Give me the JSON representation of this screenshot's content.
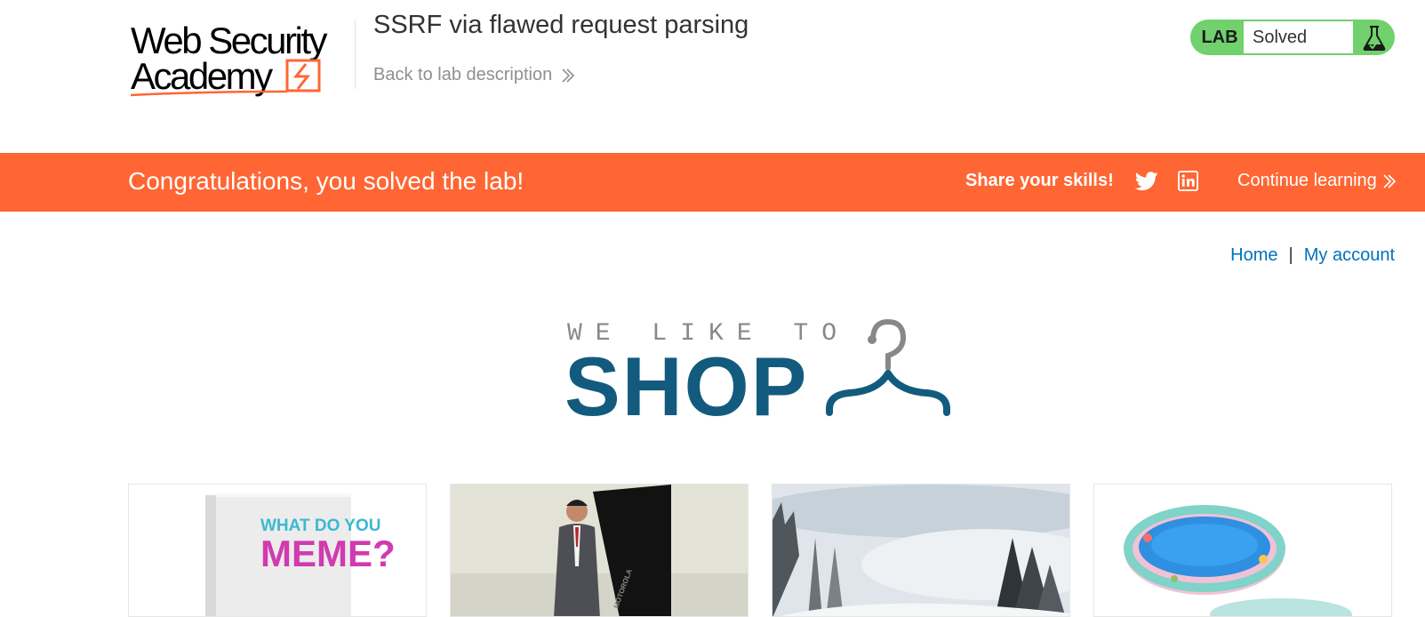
{
  "header": {
    "logo_line1": "Web Security",
    "logo_line2": "Academy",
    "lab_title": "SSRF via flawed request parsing",
    "back_link": "Back to lab description",
    "lab_badge": "LAB",
    "lab_status": "Solved"
  },
  "banner": {
    "congrats": "Congratulations, you solved the lab!",
    "share": "Share your skills!",
    "continue": "Continue learning",
    "icons": [
      "twitter-icon",
      "linkedin-icon",
      "chevron-double-right-icon"
    ]
  },
  "nav": {
    "home": "Home",
    "separator": "|",
    "account": "My account"
  },
  "hero": {
    "tagline": "WE LIKE TO",
    "title": "SHOP"
  },
  "products": {
    "items": [
      {
        "image": "what-do-you-meme-box",
        "box_text_top": "WHAT DO YOU",
        "box_text_bottom": "MEME?"
      },
      {
        "image": "businessman-figurine-phone",
        "phone_brand": "MOTOROLA"
      },
      {
        "image": "snowy-forest-landscape"
      },
      {
        "image": "inflatable-paddling-pool"
      }
    ]
  },
  "colors": {
    "accent": "#ff6633",
    "lab_green": "#70d16d",
    "link_blue": "#0071bc",
    "shop_blue": "#135b7e"
  }
}
